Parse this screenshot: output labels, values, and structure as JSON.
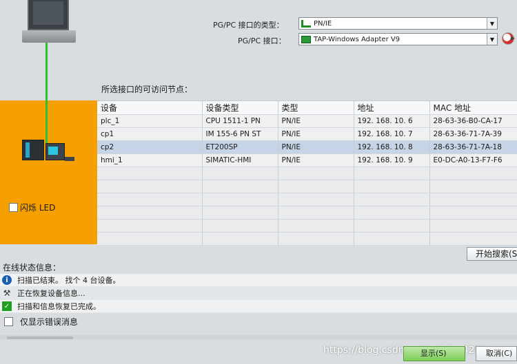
{
  "interface": {
    "type_label": "PG/PC 接口的类型：",
    "type_value": "PN/IE",
    "iface_label": "PG/PC 接口：",
    "iface_value": "TAP-Windows Adapter V9"
  },
  "nodes_label": "所选接口的可访问节点：",
  "flash_led_label": "闪烁 LED",
  "table": {
    "headers": [
      "设备",
      "设备类型",
      "类型",
      "地址",
      "MAC 地址"
    ],
    "rows": [
      [
        "plc_1",
        "CPU 1511-1 PN",
        "PN/IE",
        "192. 168. 10. 6",
        "28-63-36-B0-CA-17"
      ],
      [
        "cp1",
        "IM 155-6 PN ST",
        "PN/IE",
        "192. 168. 10. 7",
        "28-63-36-71-7A-39"
      ],
      [
        "cp2",
        "ET200SP",
        "PN/IE",
        "192. 168. 10. 8",
        "28-63-36-71-7A-18"
      ],
      [
        "hmi_1",
        "SIMATIC-HMI",
        "PN/IE",
        "192. 168. 10. 9",
        "E0-DC-A0-13-F7-F6"
      ]
    ]
  },
  "scan_button": "开始搜索(S",
  "status": {
    "title": "在线状态信息：",
    "items": [
      {
        "text": "扫描已结束。 找个 4 台设备。"
      },
      {
        "text": "正在恢复设备信息..."
      },
      {
        "text": "扫描和信息恢复已完成。"
      }
    ],
    "errors_only_label": "仅显示错误消息"
  },
  "watermark": "https://blog.csdn.net/weixin_4286...",
  "footer": {
    "show_button": "显示(S)",
    "cancel_button": "取消(C)"
  }
}
